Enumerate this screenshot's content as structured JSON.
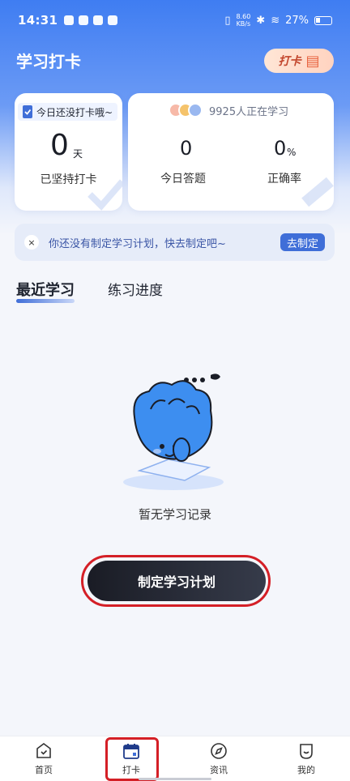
{
  "status_bar": {
    "time": "14:31",
    "net_speed_value": "8.60",
    "net_speed_unit": "KB/s",
    "battery": "27%"
  },
  "header": {
    "title": "学习打卡",
    "checkin_tag": "打卡"
  },
  "streak_card": {
    "pill_text": "今日还没打卡哦~",
    "days_value": "0",
    "days_unit": "天",
    "label": "已坚持打卡"
  },
  "stats_card": {
    "learning_count_text": "9925人正在学习",
    "today_answers_value": "0",
    "today_answers_label": "今日答题",
    "accuracy_value": "0",
    "accuracy_unit": "%",
    "accuracy_label": "正确率"
  },
  "notice": {
    "close_glyph": "×",
    "text": "你还没有制定学习计划，快去制定吧~",
    "action_label": "去制定"
  },
  "tabs": [
    {
      "label": "最近学习",
      "active": true
    },
    {
      "label": "练习进度",
      "active": false
    }
  ],
  "empty_state": {
    "text": "暂无学习记录",
    "button_label": "制定学习计划"
  },
  "bottom_nav": {
    "items": [
      {
        "label": "首页",
        "icon": "home-icon"
      },
      {
        "label": "打卡",
        "icon": "calendar-icon",
        "active": true
      },
      {
        "label": "资讯",
        "icon": "compass-icon"
      },
      {
        "label": "我的",
        "icon": "profile-icon"
      }
    ]
  },
  "colors": {
    "accent": "#3f6ed8",
    "header_gradient_top": "#3f7df2",
    "highlight_outline": "#d41f26"
  }
}
